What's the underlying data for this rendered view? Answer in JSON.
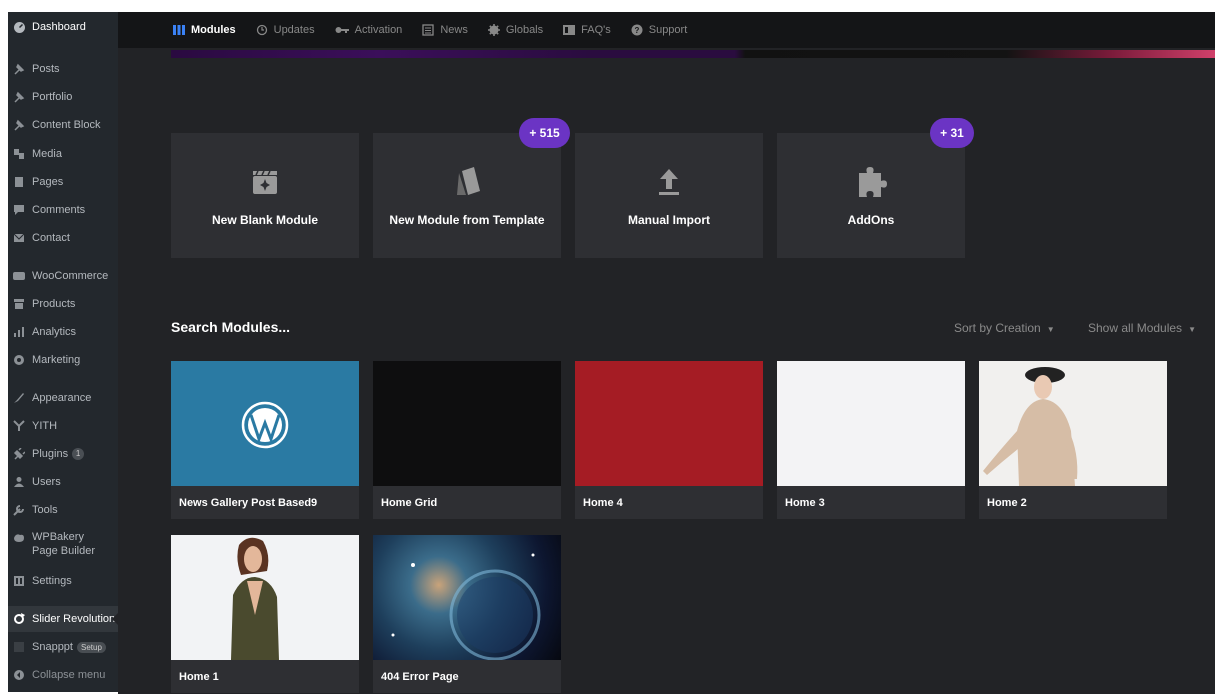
{
  "sidebar": {
    "items": [
      {
        "label": "Dashboard",
        "icon": "dashboard-icon"
      },
      {
        "label": "Posts",
        "icon": "pin-icon"
      },
      {
        "label": "Portfolio",
        "icon": "pin-icon"
      },
      {
        "label": "Content Block",
        "icon": "pin-icon"
      },
      {
        "label": "Media",
        "icon": "media-icon"
      },
      {
        "label": "Pages",
        "icon": "pages-icon"
      },
      {
        "label": "Comments",
        "icon": "comment-icon"
      },
      {
        "label": "Contact",
        "icon": "mail-icon"
      },
      {
        "label": "WooCommerce",
        "icon": "woocommerce-icon"
      },
      {
        "label": "Products",
        "icon": "archive-icon"
      },
      {
        "label": "Analytics",
        "icon": "bar-chart-icon"
      },
      {
        "label": "Marketing",
        "icon": "megaphone-icon"
      },
      {
        "label": "Appearance",
        "icon": "brush-icon"
      },
      {
        "label": "YITH",
        "icon": "yith-icon"
      },
      {
        "label": "Plugins",
        "icon": "plugin-icon",
        "badge": "1"
      },
      {
        "label": "Users",
        "icon": "users-icon"
      },
      {
        "label": "Tools",
        "icon": "wrench-icon"
      },
      {
        "label": "WPBakery Page Builder",
        "icon": "wpbakery-icon"
      },
      {
        "label": "Settings",
        "icon": "settings-icon"
      },
      {
        "label": "Slider Revolution",
        "icon": "refresh-icon"
      },
      {
        "label": "Snapppt",
        "icon": "snapppt-icon",
        "badge": "Setup"
      },
      {
        "label": "Collapse menu",
        "icon": "collapse-icon"
      }
    ]
  },
  "topnav": {
    "items": [
      {
        "label": "Modules",
        "icon": "modules-icon"
      },
      {
        "label": "Updates",
        "icon": "updates-icon"
      },
      {
        "label": "Activation",
        "icon": "key-icon"
      },
      {
        "label": "News",
        "icon": "news-icon"
      },
      {
        "label": "Globals",
        "icon": "gear-icon"
      },
      {
        "label": "FAQ's",
        "icon": "faq-icon"
      },
      {
        "label": "Support",
        "icon": "support-icon"
      }
    ]
  },
  "actions": [
    {
      "label": "New Blank Module",
      "icon": "blank-module-icon"
    },
    {
      "label": "New Module from Template",
      "icon": "template-icon",
      "count": "+ 515"
    },
    {
      "label": "Manual Import",
      "icon": "upload-icon"
    },
    {
      "label": "AddOns",
      "icon": "puzzle-icon",
      "count": "+ 31"
    }
  ],
  "modules_header": {
    "title": "Search Modules...",
    "sort": "Sort by Creation",
    "filter": "Show all Modules"
  },
  "modules": [
    {
      "label": "News Gallery Post Based9",
      "thumb": "wordpress-logo"
    },
    {
      "label": "Home Grid",
      "thumb": "black"
    },
    {
      "label": "Home 4",
      "thumb": "red"
    },
    {
      "label": "Home 3",
      "thumb": "white"
    },
    {
      "label": "Home 2",
      "thumb": "photo-woman-hat"
    },
    {
      "label": "Home 1",
      "thumb": "photo-woman-plaid"
    },
    {
      "label": "404 Error Page",
      "thumb": "nebula"
    }
  ],
  "colors": {
    "accent": "#6b34c4",
    "sidebar_active": "#0073aa",
    "panel_bg": "#222326",
    "card_bg": "#2e2f33"
  }
}
